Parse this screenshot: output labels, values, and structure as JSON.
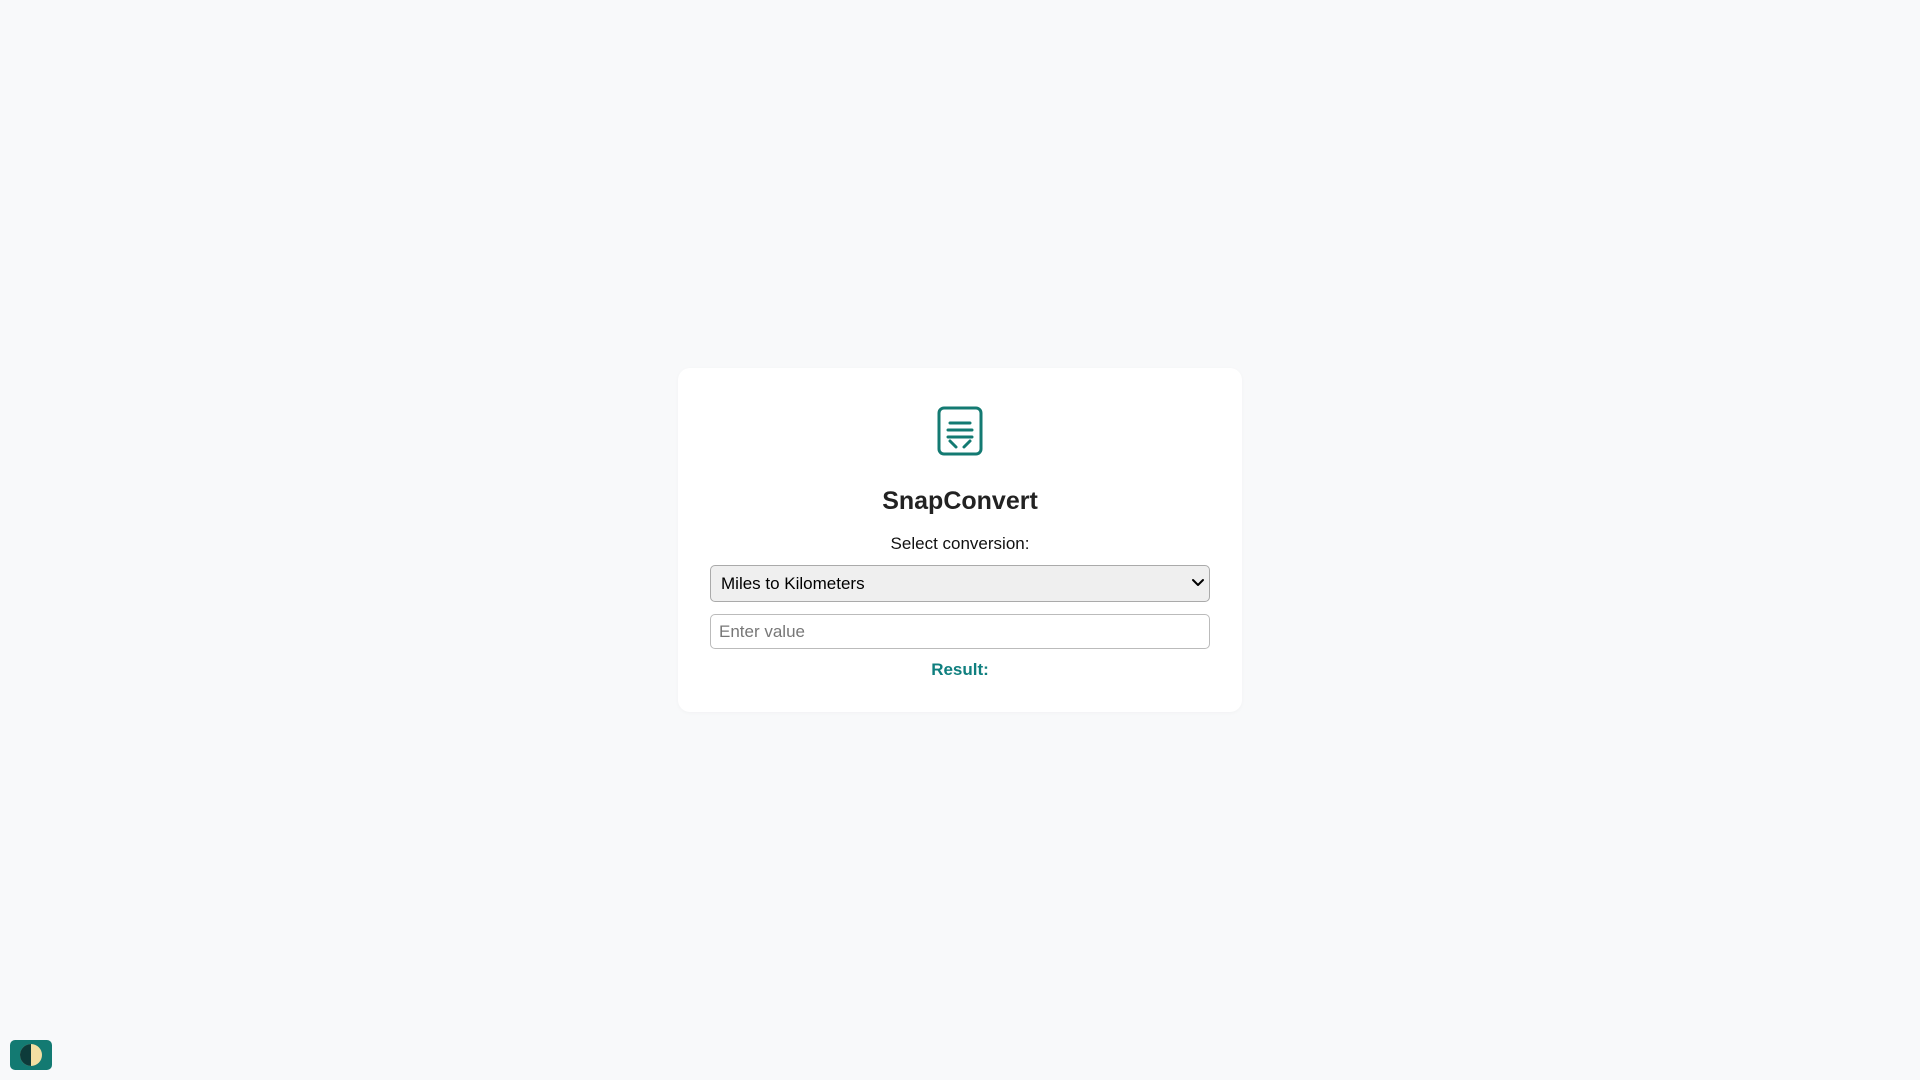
{
  "app": {
    "title": "SnapConvert",
    "brand_color": "#137a72"
  },
  "converter": {
    "select_label": "Select conversion:",
    "selected_conversion": "Miles to Kilometers",
    "options": [
      "Miles to Kilometers"
    ],
    "input_placeholder": "Enter value",
    "input_value": "",
    "result_label": "Result:"
  },
  "icons": {
    "logo": "converter-logo-icon",
    "theme_toggle": "half-moon-contrast-icon",
    "select_arrow": "chevron-down-icon"
  }
}
